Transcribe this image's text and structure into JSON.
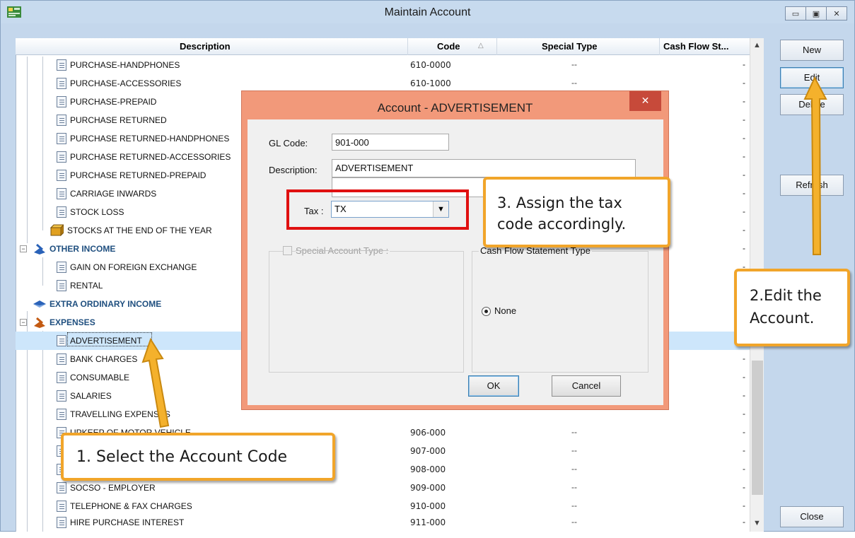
{
  "window": {
    "title": "Maintain Account"
  },
  "grid": {
    "columns": {
      "description": "Description",
      "code": "Code",
      "special_type": "Special Type",
      "cash_flow": "Cash Flow St..."
    },
    "rows": [
      {
        "desc": "PURCHASE-HANDPHONES",
        "code": "610-0000",
        "stype": "--",
        "cf": "-"
      },
      {
        "desc": "PURCHASE-ACCESSORIES",
        "code": "610-1000",
        "stype": "--",
        "cf": "-"
      },
      {
        "desc": "PURCHASE-PREPAID",
        "code": "",
        "stype": "",
        "cf": "-"
      },
      {
        "desc": "PURCHASE RETURNED",
        "code": "",
        "stype": "",
        "cf": "-"
      },
      {
        "desc": "PURCHASE RETURNED-HANDPHONES",
        "code": "",
        "stype": "",
        "cf": "-"
      },
      {
        "desc": "PURCHASE RETURNED-ACCESSORIES",
        "code": "",
        "stype": "",
        "cf": "-"
      },
      {
        "desc": "PURCHASE RETURNED-PREPAID",
        "code": "",
        "stype": "",
        "cf": "-"
      },
      {
        "desc": "CARRIAGE INWARDS",
        "code": "",
        "stype": "",
        "cf": "-"
      },
      {
        "desc": "STOCK LOSS",
        "code": "",
        "stype": "",
        "cf": "-"
      },
      {
        "desc": "STOCKS AT THE END OF THE YEAR",
        "code": "",
        "stype": "",
        "cf": "-"
      },
      {
        "desc": "OTHER INCOME",
        "code": "",
        "stype": "",
        "cf": "-"
      },
      {
        "desc": "GAIN ON FOREIGN EXCHANGE",
        "code": "",
        "stype": "",
        "cf": "-"
      },
      {
        "desc": "RENTAL",
        "code": "",
        "stype": "",
        "cf": "-"
      },
      {
        "desc": "EXTRA ORDINARY INCOME",
        "code": "",
        "stype": "",
        "cf": "-"
      },
      {
        "desc": "EXPENSES",
        "code": "",
        "stype": "",
        "cf": "-"
      },
      {
        "desc": "ADVERTISEMENT",
        "code": "",
        "stype": "",
        "cf": ""
      },
      {
        "desc": "BANK CHARGES",
        "code": "",
        "stype": "",
        "cf": "-"
      },
      {
        "desc": "CONSUMABLE",
        "code": "",
        "stype": "",
        "cf": "-"
      },
      {
        "desc": "SALARIES",
        "code": "",
        "stype": "",
        "cf": "-"
      },
      {
        "desc": "TRAVELLING EXPENSES",
        "code": "",
        "stype": "",
        "cf": "-"
      },
      {
        "desc": "UPKEEP OF MOTOR VEHICLE",
        "code": "906-000",
        "stype": "--",
        "cf": "-"
      },
      {
        "desc": "",
        "code": "907-000",
        "stype": "--",
        "cf": "-"
      },
      {
        "desc": "",
        "code": "908-000",
        "stype": "--",
        "cf": "-"
      },
      {
        "desc": "SOCSO - EMPLOYER",
        "code": "909-000",
        "stype": "--",
        "cf": "-"
      },
      {
        "desc": "TELEPHONE & FAX CHARGES",
        "code": "910-000",
        "stype": "--",
        "cf": "-"
      },
      {
        "desc": "HIRE PURCHASE INTEREST",
        "code": "911-000",
        "stype": "--",
        "cf": "-"
      }
    ]
  },
  "side_buttons": {
    "new": "New",
    "edit": "Edit",
    "delete": "Delete",
    "refresh": "Refresh",
    "close": "Close"
  },
  "dialog": {
    "title": "Account - ADVERTISEMENT",
    "close_glyph": "✕",
    "gl_code_label": "GL Code:",
    "gl_code_value": "901-000",
    "description_label": "Description:",
    "description_value": "ADVERTISEMENT",
    "tax_label": "Tax :",
    "tax_value": "TX",
    "special_account_type_label": "Special Account Type :",
    "cash_flow_label": "Cash Flow Statement Type",
    "none_label": "None",
    "ok_label": "OK",
    "cancel_label": "Cancel"
  },
  "callouts": {
    "step1": "1. Select the Account Code",
    "step2": "2.Edit the Account.",
    "step3": "3. Assign the tax code accordingly."
  },
  "colors": {
    "accent": "#f1a52a",
    "highlight": "#e01010",
    "dialog_frame": "#f2997a"
  }
}
